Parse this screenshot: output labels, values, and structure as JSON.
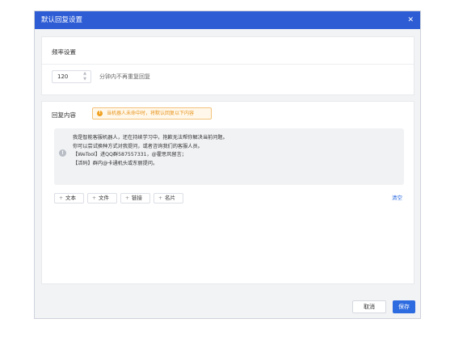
{
  "dialog": {
    "title": "默认回复设置",
    "close_glyph": "✕"
  },
  "frequency": {
    "section_title": "频率设置",
    "value": "120",
    "suffix": "分钟内不再重复回复"
  },
  "reply": {
    "section_title": "回复内容",
    "warning_icon": "!",
    "warning": "当机器人未命中时，将默认回复以下内容",
    "message_lines": [
      "我是智能客服机器人，还在持续学习中，抱歉无法帮你解决当前问题。",
      "你可以尝试换种方式对我提问，或者咨询我们的客服人员。",
      "【WeTool】进QQ群587557331，@霍思风留言；",
      "【活码】群内@卡通机头或东丽提问。"
    ],
    "insert_buttons": [
      {
        "plus": "+",
        "label": "文本"
      },
      {
        "plus": "+",
        "label": "文件"
      },
      {
        "plus": "+",
        "label": "链接"
      },
      {
        "plus": "+",
        "label": "名片"
      }
    ],
    "clear_label": "清空"
  },
  "footer": {
    "cancel_label": "取消",
    "save_label": "保存"
  },
  "colors": {
    "titlebar": "#2d5cd5",
    "primary": "#2d6be0",
    "warning": "#e8921a"
  }
}
